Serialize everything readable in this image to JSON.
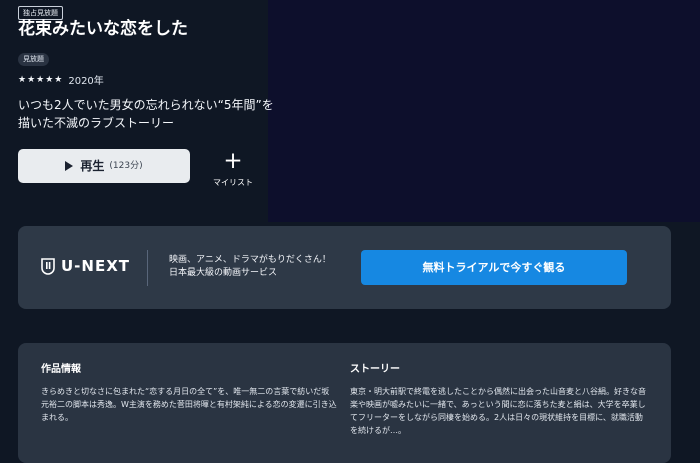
{
  "badge_top": "独占見放題",
  "title": "花束みたいな恋をした",
  "watch_badge": "見放題",
  "rating": {
    "stars_text": "★★★★★",
    "value": 4.5,
    "year": "2020年"
  },
  "description": "いつも2人でいた男女の忘れられない“5年間”を描いた不滅のラブストーリー",
  "actions": {
    "play_label": "再生",
    "duration": "(123分)",
    "mylist_label": "マイリスト"
  },
  "promo": {
    "logo_text": "U-NEXT",
    "copy_line_1": "映画、アニメ、ドラマがもりだくさん！",
    "copy_line_2": "日本最大級の動画サービス",
    "cta_label": "無料トライアルで今すぐ観る"
  },
  "info": {
    "work_heading": "作品情報",
    "work_text": "きらめきと切なさに包まれた“恋する月日の全て”を、唯一無二の言葉で紡いだ坂元裕二の脚本は秀逸。W主演を務めた菅田将暉と有村架純による恋の変遷に引き込まれる。",
    "story_heading": "ストーリー",
    "story_text": "東京・明大前駅で終電を逃したことから偶然に出会った山音麦と八谷絹。好きな音楽や映画が嘘みたいに一緒で、あっという間に恋に落ちた麦と絹は、大学を卒業してフリーターをしながら同棲を始める。2人は日々の現状維持を目標に、就職活動を続けるが…。"
  },
  "colors": {
    "background": "#0f1724",
    "hero": "#0d0f2c",
    "promo_box": "#2e3947",
    "cta": "#1688e2",
    "info_panel": "#2a3442"
  },
  "icons": {
    "play": "play-icon",
    "plus": "plus-icon",
    "logo": "u-next-shield-icon",
    "stars": "star-icon"
  }
}
